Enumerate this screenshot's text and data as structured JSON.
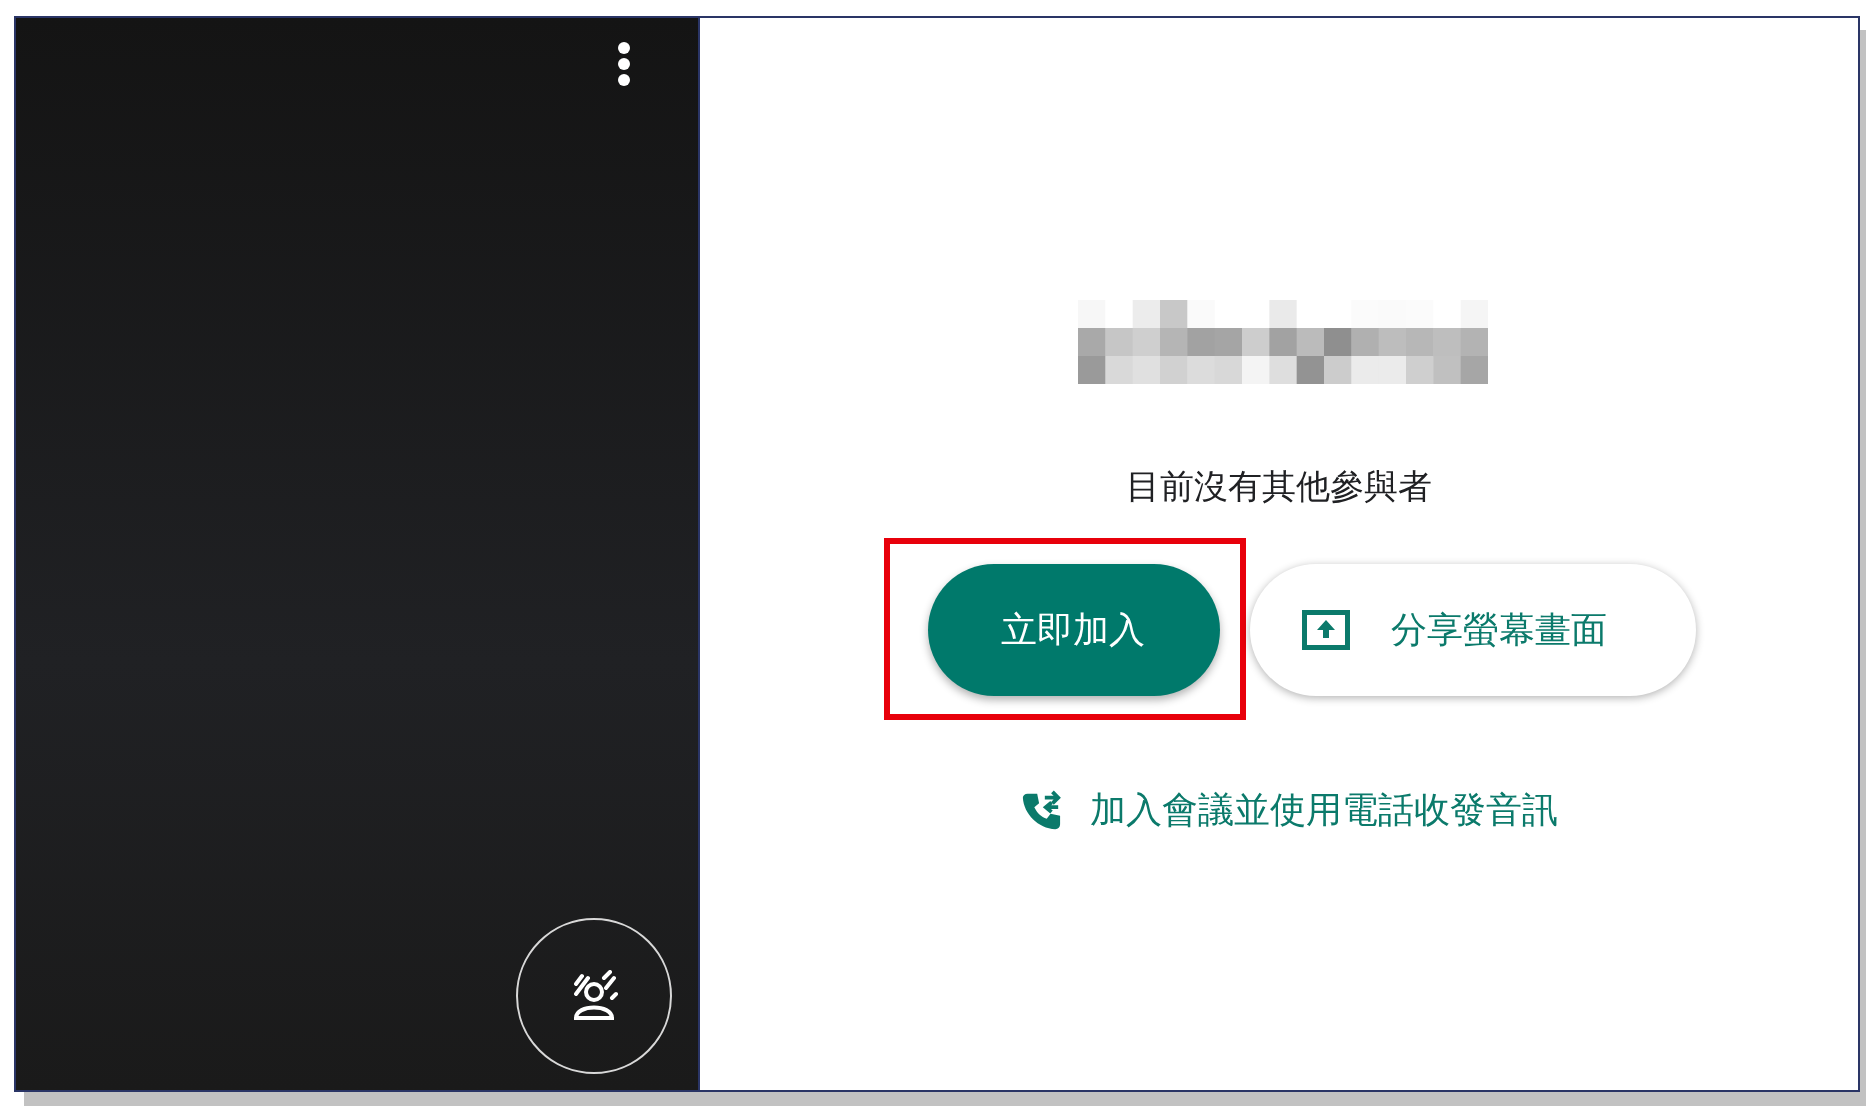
{
  "status": "目前沒有其他參與者",
  "join_button": {
    "label": "立即加入",
    "highlighted": true
  },
  "share_button": {
    "label": "分享螢幕畫面"
  },
  "phone_link": {
    "label": "加入會議並使用電話收發音訊"
  }
}
